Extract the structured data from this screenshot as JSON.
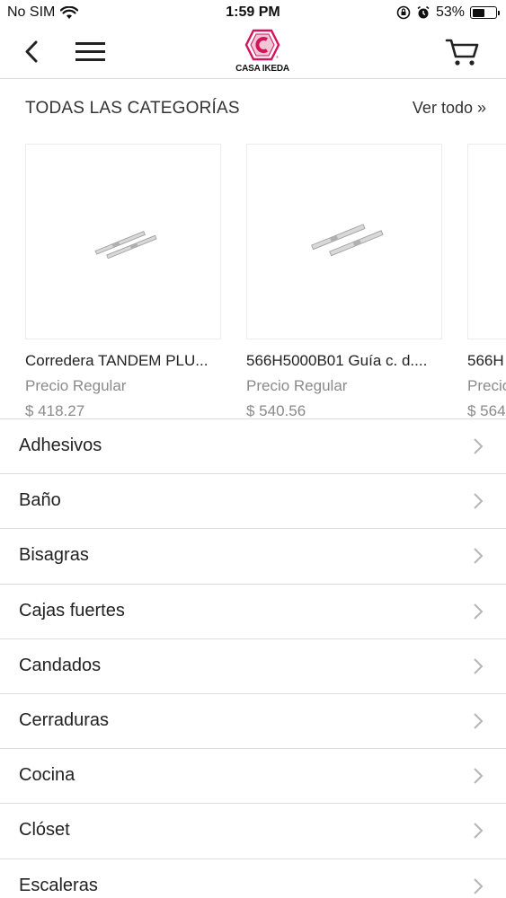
{
  "status_bar": {
    "carrier": "No SIM",
    "time": "1:59 PM",
    "battery_percent": "53%",
    "battery_level": 0.53
  },
  "nav": {
    "brand": "CASA IKEDA",
    "brand_color": "#d4145a"
  },
  "section": {
    "title": "TODAS LAS CATEGORÍAS",
    "view_all": "Ver todo »"
  },
  "products": [
    {
      "name": "Corredera TANDEM PLU...",
      "price_label": "Precio Regular",
      "price": "$ 418.27"
    },
    {
      "name": "566H5000B01 Guía c. d....",
      "price_label": "Precio Regular",
      "price": "$ 540.56"
    },
    {
      "name": "566H",
      "price_label": "Precio",
      "price": "$ 564"
    }
  ],
  "categories": [
    "Adhesivos",
    "Baño",
    "Bisagras",
    "Cajas fuertes",
    "Candados",
    "Cerraduras",
    "Cocina",
    "Clóset",
    "Escaleras"
  ]
}
